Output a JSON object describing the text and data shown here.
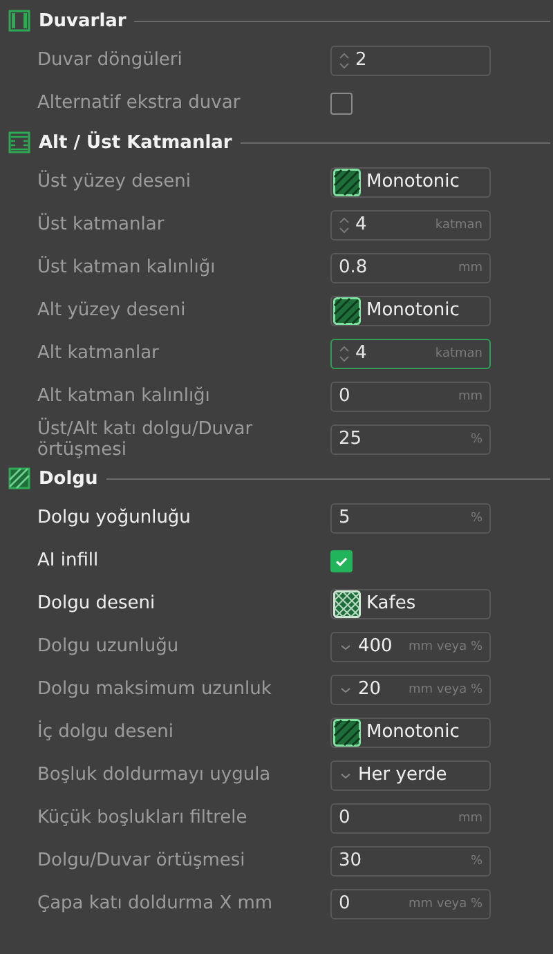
{
  "sections": [
    {
      "title": "Duvarlar",
      "kind": "walls",
      "rows": [
        {
          "label": "Duvar döngüleri",
          "modified": false,
          "kind": "spin",
          "value": "2",
          "focused": false
        },
        {
          "label": "Alternatif ekstra duvar",
          "modified": false,
          "kind": "checkbox",
          "checked": false
        }
      ]
    },
    {
      "title": "Alt / Üst Katmanlar",
      "kind": "layers",
      "rows": [
        {
          "label": "Üst yüzey deseni",
          "modified": false,
          "kind": "pattern",
          "swatch": {
            "kind": "stripes"
          },
          "value": "Monotonic",
          "focused": false
        },
        {
          "label": "Üst katmanlar",
          "modified": false,
          "kind": "spin",
          "value": "4",
          "unit": "katman",
          "focused": false
        },
        {
          "label": "Üst katman kalınlığı",
          "modified": false,
          "kind": "input",
          "value": "0.8",
          "unit": "mm",
          "focused": false
        },
        {
          "label": "Alt yüzey deseni",
          "modified": false,
          "kind": "pattern",
          "swatch": {
            "kind": "stripes"
          },
          "value": "Monotonic",
          "focused": false
        },
        {
          "label": "Alt katmanlar",
          "modified": false,
          "kind": "spin",
          "value": "4",
          "unit": "katman",
          "focused": true
        },
        {
          "label": "Alt katman kalınlığı",
          "modified": false,
          "kind": "input",
          "value": "0",
          "unit": "mm",
          "focused": false
        },
        {
          "label": "Üst/Alt katı dolgu/Duvar örtüşmesi",
          "modified": false,
          "kind": "input",
          "value": "25",
          "unit": "%",
          "focused": false
        }
      ]
    },
    {
      "title": "Dolgu",
      "kind": "infill",
      "rows": [
        {
          "label": "Dolgu yoğunluğu",
          "modified": true,
          "kind": "input",
          "value": "5",
          "unit": "%",
          "focused": false
        },
        {
          "label": "AI infill",
          "modified": true,
          "kind": "checkbox",
          "checked": true
        },
        {
          "label": "Dolgu deseni",
          "modified": true,
          "kind": "pattern",
          "swatch": {
            "kind": "grid"
          },
          "value": "Kafes",
          "focused": false
        },
        {
          "label": "Dolgu uzunluğu",
          "modified": false,
          "kind": "combo",
          "value": "400",
          "unit": "mm veya %",
          "focused": false
        },
        {
          "label": "Dolgu maksimum uzunluk",
          "modified": false,
          "kind": "combo",
          "value": "20",
          "unit": "mm veya %",
          "focused": false
        },
        {
          "label": "İç dolgu deseni",
          "modified": false,
          "kind": "pattern",
          "swatch": {
            "kind": "stripes"
          },
          "value": "Monotonic",
          "focused": false
        },
        {
          "label": "Boşluk doldurmayı uygula",
          "modified": false,
          "kind": "combo",
          "value": "Her yerde",
          "focused": false
        },
        {
          "label": "Küçük boşlukları filtrele",
          "modified": false,
          "kind": "input",
          "value": "0",
          "unit": "mm",
          "focused": false
        },
        {
          "label": "Dolgu/Duvar örtüşmesi",
          "modified": false,
          "kind": "input",
          "value": "30",
          "unit": "%",
          "focused": false
        },
        {
          "label": "Çapa katı doldurma X mm",
          "modified": false,
          "kind": "input",
          "value": "0",
          "unit": "mm veya %",
          "focused": false
        }
      ]
    }
  ]
}
